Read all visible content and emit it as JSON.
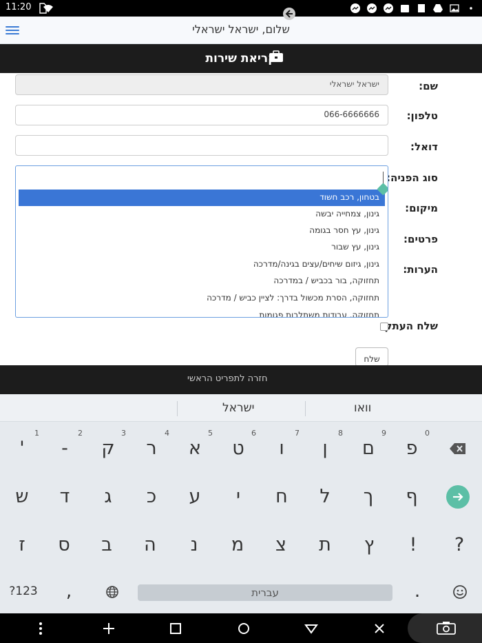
{
  "status": {
    "time": "11:20"
  },
  "header": {
    "greeting": "שלום, ישראל ישראלי",
    "title": "קריאת שירות"
  },
  "form": {
    "name_label": "שם:",
    "name_value": "ישראל ישראלי",
    "phone_label": "טלפון:",
    "phone_value": "066-6666666",
    "email_label": "דואל:",
    "email_value": "",
    "type_label": "סוג הפניה:",
    "location_label": "מיקום:",
    "details_label": "פרטים:",
    "notes_label": "הערות:",
    "copy_label": "שלח העתק:",
    "send_label": "שלח"
  },
  "dropdown": {
    "options": [
      "בטחון, רכב חשוד",
      "גינון, צמחייה יבשה",
      "גינון, עץ חסר בגומה",
      "גינון, עץ שבור",
      "גינון, גיזום שיחים/עצים בגינה/מדרכה",
      "תחזוקה, בור בכביש / במדרכה",
      "תחזוקה, הסרת מכשול בדרך: לציין כביש / מדרכה",
      "תחזוקה, עבודות משתלבות פגומות"
    ],
    "selected_index": 0
  },
  "footer": {
    "back_label": "חזרה לתפריט הראשי"
  },
  "keyboard": {
    "suggestions": [
      "וואו",
      "ישראל"
    ],
    "row1": [
      "פ",
      "ם",
      "ן",
      "ו",
      "ט",
      "א",
      "ר",
      "ק",
      "-",
      "'"
    ],
    "row1_hints": [
      "0",
      "9",
      "8",
      "7",
      "6",
      "5",
      "4",
      "3",
      "2",
      "1"
    ],
    "row2": [
      "ף",
      "ך",
      "ל",
      "ח",
      "י",
      "ע",
      "כ",
      "ג",
      "ד",
      "ש"
    ],
    "row3": [
      "?",
      "!",
      "ץ",
      "ת",
      "צ",
      "מ",
      "נ",
      "ה",
      "ב",
      "ס",
      "ז"
    ],
    "row4_symbols": "?123",
    "row4_comma": ",",
    "row4_period": ".",
    "space_label": "עברית"
  },
  "colors": {
    "accent": "#3a76d6",
    "dark_bar": "#1c1c1c",
    "handle": "#5cbfa6"
  }
}
